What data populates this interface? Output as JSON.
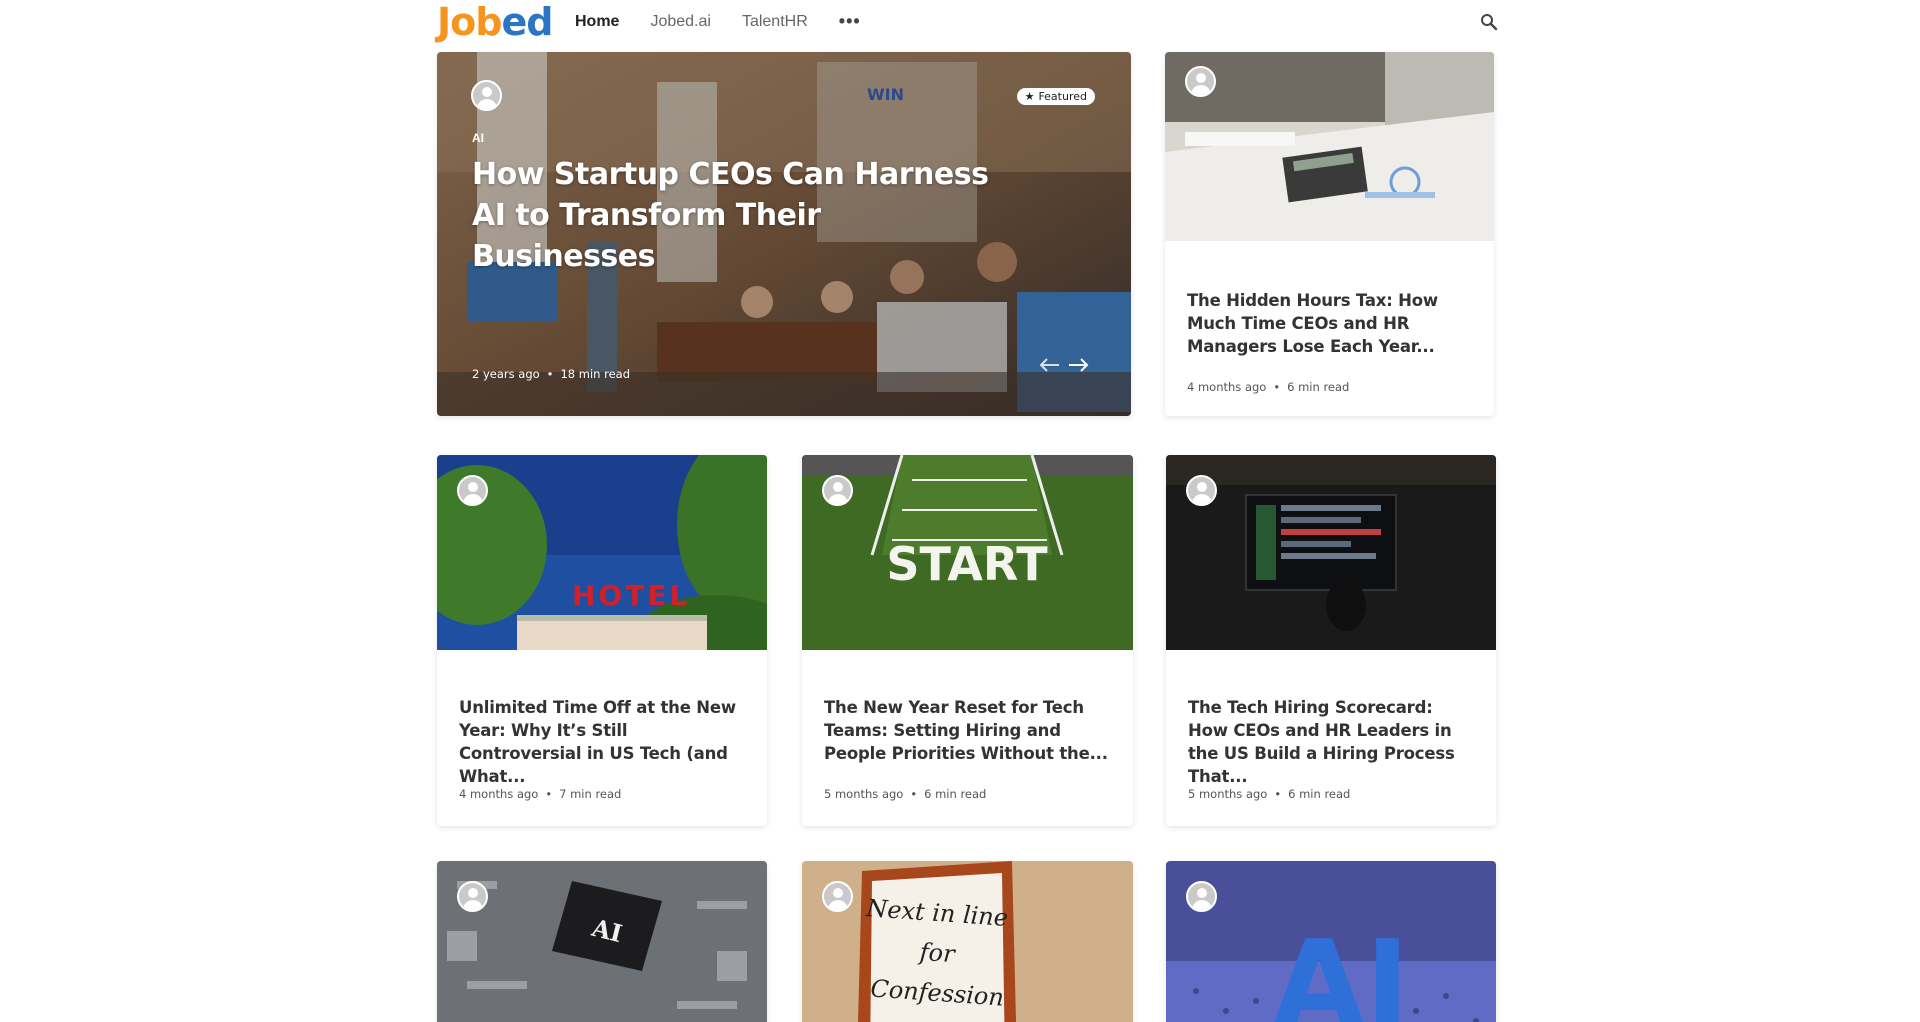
{
  "header": {
    "logo_part1": "Job",
    "logo_part2": "ed",
    "nav": [
      "Home",
      "Jobed.ai",
      "TalentHR"
    ],
    "more_label": "•••"
  },
  "featured": {
    "badge": "Featured",
    "tag": "AI",
    "title": "How Startup CEOs Can Harness AI to Transform Their Businesses",
    "time": "2 years ago",
    "read": "18 min read"
  },
  "cards": [
    {
      "title": "The Hidden Hours Tax: How Much Time CEOs and HR Managers Lose Each Year...",
      "time": "4 months ago",
      "read": "6 min read"
    },
    {
      "title": "Unlimited Time Off at the New Year: Why It’s Still Controversial in US Tech (and What...",
      "time": "4 months ago",
      "read": "7 min read"
    },
    {
      "title": "The New Year Reset for Tech Teams: Setting Hiring and People Priorities Without the...",
      "time": "5 months ago",
      "read": "6 min read"
    },
    {
      "title": "The Tech Hiring Scorecard: How CEOs and HR Leaders in the US Build a Hiring Process That...",
      "time": "5 months ago",
      "read": "6 min read"
    }
  ],
  "image_text": {
    "hotel": "HOTEL",
    "start": "START",
    "ai_chip": "AI",
    "confession_l1": "Next in line",
    "confession_l2": "for",
    "confession_l3": "Confession",
    "ai_big": "AI",
    "win": "WIN"
  },
  "separator": "•",
  "colors": {
    "logo_orange": "#f5951f",
    "logo_blue": "#2d74c4"
  }
}
